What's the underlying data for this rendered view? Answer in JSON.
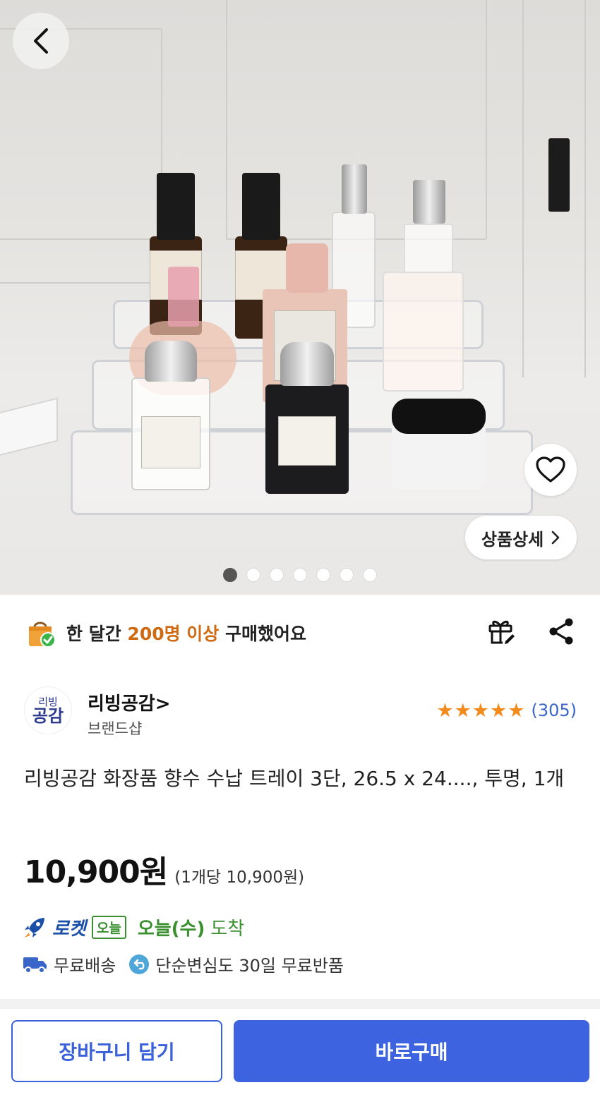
{
  "hero": {
    "image_alt": "",
    "detail_label": "상품상세",
    "carousel": {
      "total": 7,
      "active": 1
    }
  },
  "social_proof": {
    "prefix": "한 달간 ",
    "highlight": "200명 이상",
    "suffix": " 구매했어요"
  },
  "seller": {
    "logo_line1": "리빙",
    "logo_line2": "공감",
    "name": "리빙공감",
    "name_chevron": ">",
    "subtitle": "브랜드샵",
    "rating_stars": 5,
    "review_count": "(305)"
  },
  "product": {
    "title": "리빙공감 화장품 향수 수납 트레이 3단, 26.5 x 24...., 투명, 1개",
    "price": "10,900원",
    "unit_price": "(1개당 10,900원)"
  },
  "delivery": {
    "rocket_label": "로켓",
    "today_badge": "오늘",
    "arrive_date": "오늘(수)",
    "arrive_text": "도착"
  },
  "benefits": {
    "free_shipping": "무료배송",
    "free_return": "단순변심도 30일 무료반품"
  },
  "actions": {
    "cart_label": "장바구니 담기",
    "buy_label": "바로구매"
  },
  "colors": {
    "accent_blue": "#3d63e0",
    "highlight_orange": "#cf6a12",
    "rocket_green": "#3a8f2f",
    "star_orange": "#f28a1c"
  }
}
